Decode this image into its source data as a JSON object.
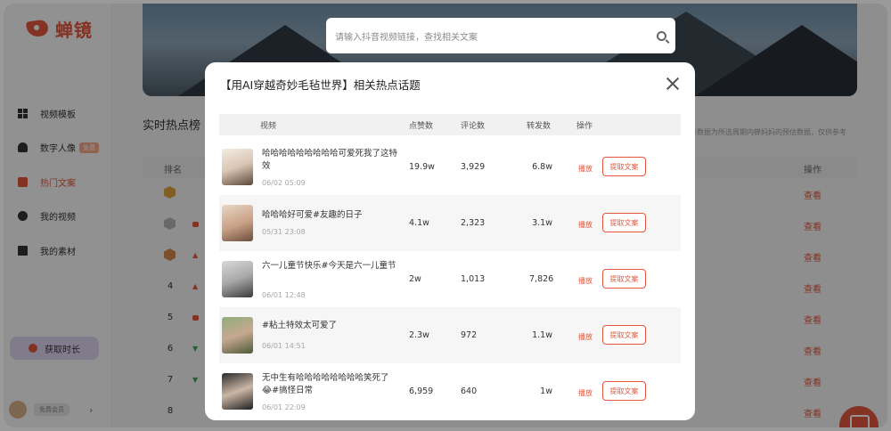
{
  "app": {
    "logo_text": "蝉镜"
  },
  "sidebar": {
    "items": [
      {
        "label": "视频模板",
        "icon": "grid-icon"
      },
      {
        "label": "数字人像",
        "icon": "person-icon",
        "badge": "免费"
      },
      {
        "label": "热门文案",
        "icon": "doc-icon",
        "active": true
      },
      {
        "label": "我的视频",
        "icon": "play-circle-icon"
      },
      {
        "label": "我的素材",
        "icon": "folder-icon"
      }
    ],
    "get_time_label": "获取时长",
    "plan_label": "免费会员"
  },
  "search": {
    "placeholder": "请输入抖音视频链接，查找相关文案"
  },
  "section": {
    "title": "实时热点榜",
    "note": "示数据为所选周期内蝉妈妈的预估数据，仅供参考"
  },
  "rank_table": {
    "col_rank": "排名",
    "col_action": "操作",
    "view_label": "查看",
    "rows": [
      {
        "rank": "1",
        "medal": "gold"
      },
      {
        "rank": "2",
        "medal": "silver",
        "trend": "new"
      },
      {
        "rank": "3",
        "medal": "bronze",
        "trend": "up"
      },
      {
        "rank": "4",
        "trend": "up"
      },
      {
        "rank": "5",
        "trend": "new"
      },
      {
        "rank": "6",
        "trend": "down"
      },
      {
        "rank": "7",
        "trend": "down"
      },
      {
        "rank": "8"
      }
    ]
  },
  "modal": {
    "title": "【用AI穿越奇妙毛毡世界】相关热点话题",
    "columns": {
      "video": "视频",
      "likes": "点赞数",
      "comments": "评论数",
      "shares": "转发数",
      "action": "操作"
    },
    "play_label": "播放",
    "extract_label": "提取文案",
    "rows": [
      {
        "title": "哈哈哈哈哈哈哈哈哈可爱死我了这特效",
        "date": "06/02 05:09",
        "likes": "19.9w",
        "comments": "3,929",
        "shares": "6.8w"
      },
      {
        "title": "哈哈哈好可爱#友趣的日子",
        "date": "05/31 23:08",
        "likes": "4.1w",
        "comments": "2,323",
        "shares": "3.1w"
      },
      {
        "title": "六一儿童节快乐#今天是六一儿童节",
        "date": "06/01 12:48",
        "likes": "2w",
        "comments": "1,013",
        "shares": "7,826"
      },
      {
        "title": "#粘土特效太可爱了",
        "date": "06/01 14:51",
        "likes": "2.3w",
        "comments": "972",
        "shares": "1.1w"
      },
      {
        "title": "无中生有哈哈哈哈哈哈哈哈笑死了😂#搞怪日常",
        "date": "06/01 22:09",
        "likes": "6,959",
        "comments": "640",
        "shares": "1w"
      }
    ]
  },
  "colors": {
    "accent": "#e4573d",
    "overlay": "rgba(0,0,0,0.42)"
  }
}
